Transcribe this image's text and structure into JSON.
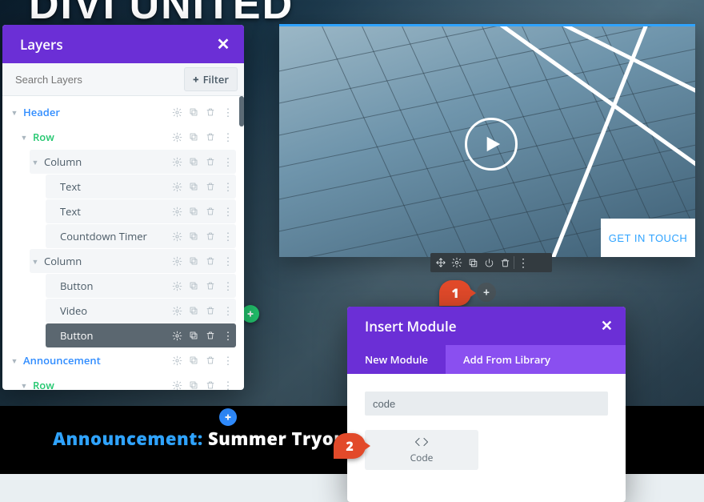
{
  "brand_text": "DIVI UNITED",
  "hero": {
    "cta_label": "GET IN TOUCH"
  },
  "announcement": {
    "label": "Announcement:",
    "body": "Summer Tryouts Be"
  },
  "layers_panel": {
    "title": "Layers",
    "search_placeholder": "Search Layers",
    "filter_label": "Filter",
    "rows": {
      "header": "Header",
      "row_a": "Row",
      "column_a": "Column",
      "text_a": "Text",
      "text_b": "Text",
      "countdown": "Countdown Timer",
      "column_b": "Column",
      "button_a": "Button",
      "video": "Video",
      "button_b_sel": "Button",
      "announcement": "Announcement",
      "row_b": "Row"
    }
  },
  "markers": {
    "one": "1",
    "two": "2"
  },
  "insert_panel": {
    "title": "Insert Module",
    "tab_new": "New Module",
    "tab_library": "Add From Library",
    "search_value": "code",
    "module_label": "Code"
  },
  "icon_labels": {
    "plus": "+",
    "dots": "⋮"
  }
}
